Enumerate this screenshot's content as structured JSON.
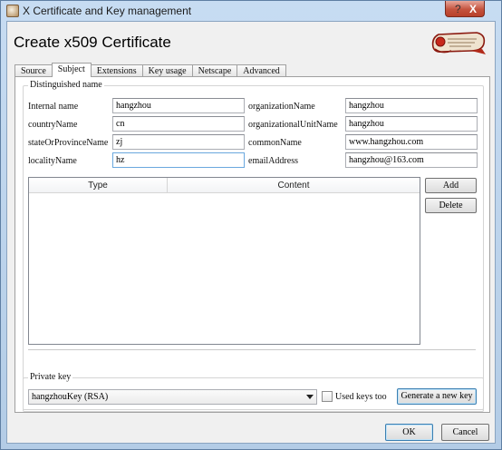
{
  "window": {
    "title": "X Certificate and Key management",
    "help_glyph": "?",
    "close_glyph": "X"
  },
  "dialog": {
    "title": "Create x509 Certificate",
    "logo_text": "Dinarga Andriana Jbu"
  },
  "tabs": [
    {
      "label": "Source",
      "active": false
    },
    {
      "label": "Subject",
      "active": true
    },
    {
      "label": "Extensions",
      "active": false
    },
    {
      "label": "Key usage",
      "active": false
    },
    {
      "label": "Netscape",
      "active": false
    },
    {
      "label": "Advanced",
      "active": false
    }
  ],
  "distinguished_name": {
    "group_label": "Distinguished name",
    "left": [
      {
        "label": "Internal name",
        "value": "hangzhou"
      },
      {
        "label": "countryName",
        "value": "cn"
      },
      {
        "label": "stateOrProvinceName",
        "value": "zj"
      },
      {
        "label": "localityName",
        "value": "hz"
      }
    ],
    "right": [
      {
        "label": "organizationName",
        "value": "hangzhou"
      },
      {
        "label": "organizationalUnitName",
        "value": "hangzhou"
      },
      {
        "label": "commonName",
        "value": "www.hangzhou.com"
      },
      {
        "label": "emailAddress",
        "value": "hangzhou@163.com"
      }
    ]
  },
  "extra_table": {
    "columns": [
      "Type",
      "Content"
    ],
    "add_label": "Add",
    "delete_label": "Delete"
  },
  "private_key": {
    "group_label": "Private key",
    "selected": "hangzhouKey (RSA)",
    "used_keys_label": "Used keys too",
    "used_keys_checked": false,
    "generate_label": "Generate a new key"
  },
  "footer": {
    "ok_label": "OK",
    "cancel_label": "Cancel"
  }
}
